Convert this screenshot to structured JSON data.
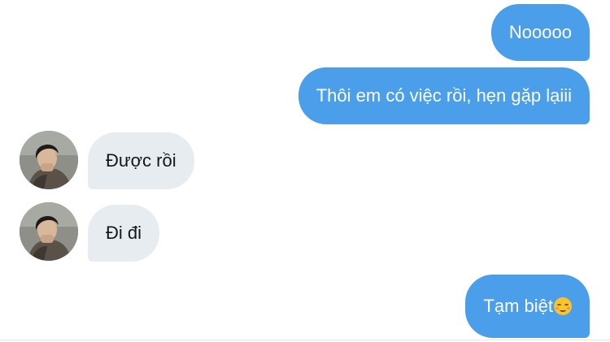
{
  "theme": {
    "accent": "#4a9eea",
    "incoming_bubble": "#e6ecf0",
    "incoming_text": "#14171a",
    "outgoing_text": "#ffffff"
  },
  "conversation": {
    "messages": [
      {
        "direction": "outgoing",
        "text": "Nooooo"
      },
      {
        "direction": "outgoing",
        "text": "Thôi em có việc rồi, hẹn gặp lạiii"
      },
      {
        "direction": "incoming",
        "text": "Được rồi",
        "avatar": "contact-avatar"
      },
      {
        "direction": "incoming",
        "text": "Đi đi",
        "avatar": "contact-avatar"
      },
      {
        "direction": "outgoing",
        "text": "Tạm biệt",
        "emoji": "smiling-face-icon"
      }
    ]
  }
}
